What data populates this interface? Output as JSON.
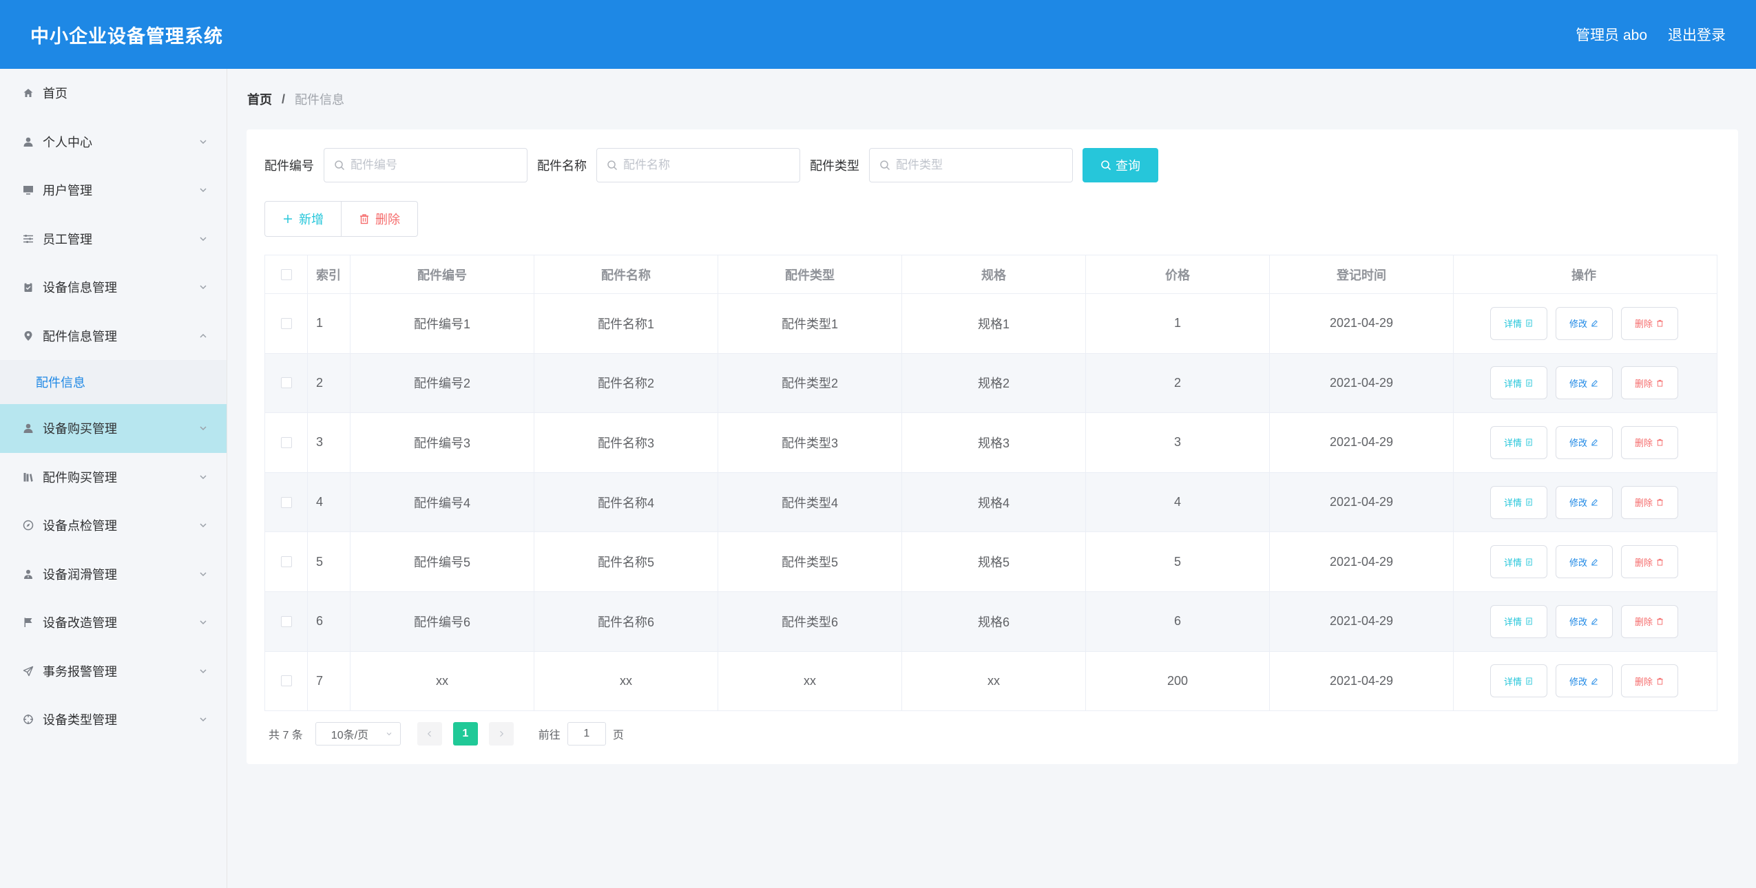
{
  "header": {
    "title": "中小企业设备管理系统",
    "user": "管理员 abo",
    "logout": "退出登录"
  },
  "sidebar": {
    "items": [
      {
        "label": "首页",
        "icon": "home-icon"
      },
      {
        "label": "个人中心",
        "icon": "user-icon"
      },
      {
        "label": "用户管理",
        "icon": "monitor-icon"
      },
      {
        "label": "员工管理",
        "icon": "sliders-icon"
      },
      {
        "label": "设备信息管理",
        "icon": "clipboard-icon"
      },
      {
        "label": "配件信息管理",
        "icon": "location-icon"
      },
      {
        "label": "设备购买管理",
        "icon": "user-icon"
      },
      {
        "label": "配件购买管理",
        "icon": "books-icon"
      },
      {
        "label": "设备点检管理",
        "icon": "compass-icon"
      },
      {
        "label": "设备润滑管理",
        "icon": "user-tie-icon"
      },
      {
        "label": "设备改造管理",
        "icon": "flag-icon"
      },
      {
        "label": "事务报警管理",
        "icon": "send-icon"
      },
      {
        "label": "设备类型管理",
        "icon": "crosshair-icon"
      }
    ],
    "submenu_label": "配件信息"
  },
  "breadcrumb": {
    "home": "首页",
    "separator": "/",
    "current": "配件信息"
  },
  "search": {
    "code_label": "配件编号",
    "code_placeholder": "配件编号",
    "name_label": "配件名称",
    "name_placeholder": "配件名称",
    "type_label": "配件类型",
    "type_placeholder": "配件类型",
    "query_button": "查询"
  },
  "actions": {
    "add": "新增",
    "delete": "删除"
  },
  "table": {
    "columns": [
      "索引",
      "配件编号",
      "配件名称",
      "配件类型",
      "规格",
      "价格",
      "登记时间",
      "操作"
    ],
    "rows": [
      {
        "index": "1",
        "code": "配件编号1",
        "name": "配件名称1",
        "type": "配件类型1",
        "spec": "规格1",
        "price": "1",
        "date": "2021-04-29"
      },
      {
        "index": "2",
        "code": "配件编号2",
        "name": "配件名称2",
        "type": "配件类型2",
        "spec": "规格2",
        "price": "2",
        "date": "2021-04-29"
      },
      {
        "index": "3",
        "code": "配件编号3",
        "name": "配件名称3",
        "type": "配件类型3",
        "spec": "规格3",
        "price": "3",
        "date": "2021-04-29"
      },
      {
        "index": "4",
        "code": "配件编号4",
        "name": "配件名称4",
        "type": "配件类型4",
        "spec": "规格4",
        "price": "4",
        "date": "2021-04-29"
      },
      {
        "index": "5",
        "code": "配件编号5",
        "name": "配件名称5",
        "type": "配件类型5",
        "spec": "规格5",
        "price": "5",
        "date": "2021-04-29"
      },
      {
        "index": "6",
        "code": "配件编号6",
        "name": "配件名称6",
        "type": "配件类型6",
        "spec": "规格6",
        "price": "6",
        "date": "2021-04-29"
      },
      {
        "index": "7",
        "code": "xx",
        "name": "xx",
        "type": "xx",
        "spec": "xx",
        "price": "200",
        "date": "2021-04-29"
      }
    ],
    "op_detail": "详情",
    "op_edit": "修改",
    "op_delete": "删除"
  },
  "pagination": {
    "total": "共 7 条",
    "page_size": "10条/页",
    "current_page": "1",
    "goto_label": "前往",
    "goto_value": "1",
    "goto_suffix": "页"
  },
  "colors": {
    "header_bg": "#1e88e5",
    "active_menu_bg": "#b7e6ef",
    "query_button": "#26c6da",
    "current_page": "#20c997",
    "danger": "#f56c6c"
  }
}
